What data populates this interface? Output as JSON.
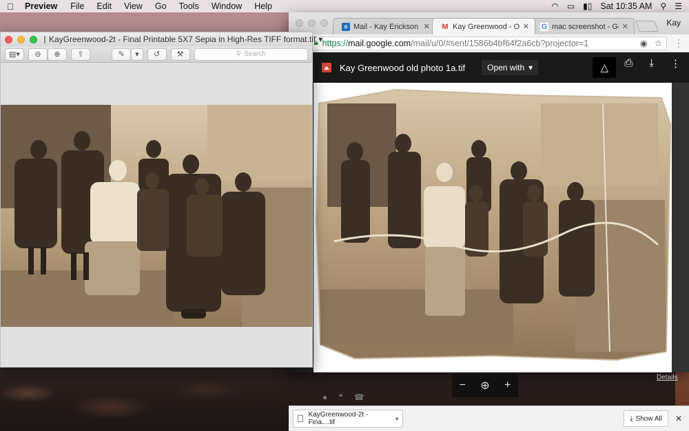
{
  "menubar": {
    "app_name": "Preview",
    "items": [
      "File",
      "Edit",
      "View",
      "Go",
      "Tools",
      "Window",
      "Help"
    ],
    "clock": "Sat 10:35 AM"
  },
  "preview": {
    "title": "KayGreenwood-2t - Final Printable 5X7 Sepia in High-Res TIFF format.tif",
    "search_placeholder": "Search"
  },
  "chrome": {
    "tabs": [
      {
        "label": "Mail - Kay Erickson Gree",
        "favicon": "outlook-icon"
      },
      {
        "label": "Kay Greenwood - OLD P",
        "favicon": "gmail-icon"
      },
      {
        "label": "mac screenshot - Googl",
        "favicon": "google-icon"
      }
    ],
    "profile": "Kay",
    "url": {
      "scheme": "https://",
      "host": "mail.google.com",
      "path": "/mail/u/0/#sent/1586b4bf64f2a6cb?projector=1"
    },
    "viewer": {
      "filename": "Kay Greenwood old photo 1a.tif",
      "open_with": "Open with",
      "details": "Details"
    },
    "download": {
      "file": "KayGreenwood-2t - Fina....tif",
      "show_all": "Show All"
    }
  },
  "colors": {
    "sepia_light": "#d8c7a8",
    "sepia_mid": "#9c8466",
    "sepia_dark": "#3a2e24",
    "gmail_red": "#d93025"
  }
}
